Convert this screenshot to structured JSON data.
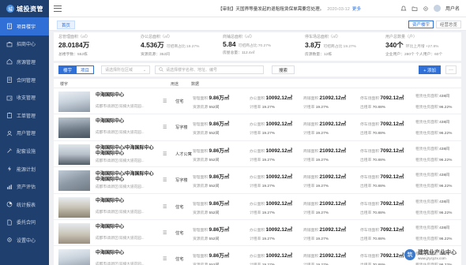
{
  "app": {
    "logo_text": "城投资管",
    "logo_mark": "城"
  },
  "sidebar": {
    "items": [
      {
        "label": "项目楼宇",
        "icon": "building-icon",
        "active": true
      },
      {
        "label": "招商中心",
        "icon": "briefcase-icon"
      },
      {
        "label": "房源管理",
        "icon": "house-icon"
      },
      {
        "label": "合同管理",
        "icon": "contract-icon"
      },
      {
        "label": "收支管理",
        "icon": "wallet-icon"
      },
      {
        "label": "工单管理",
        "icon": "clipboard-icon"
      },
      {
        "label": "用户管理",
        "icon": "user-icon"
      },
      {
        "label": "配套设施",
        "icon": "tools-icon"
      },
      {
        "label": "能源计划",
        "icon": "bolt-icon"
      },
      {
        "label": "资产评估",
        "icon": "chart-icon"
      },
      {
        "label": "统计报表",
        "icon": "report-icon"
      },
      {
        "label": "委托合同",
        "icon": "document-icon"
      },
      {
        "label": "设置中心",
        "icon": "gear-icon"
      }
    ]
  },
  "topbar": {
    "notice_tag": "【审批】",
    "notice_text": "天国界等量发起的退租租赁保单需要您处理。",
    "notice_date": "2020-03-12",
    "notice_more": "更多",
    "username": "用户名"
  },
  "tabs": {
    "home": "首页",
    "asset_tree": "资产楼宇",
    "overview": "经营总览"
  },
  "stats": [
    {
      "label": "总管理面积（㎡）",
      "value": "28.0184万",
      "sub": "",
      "foot": "总楼宇数：552栋"
    },
    {
      "label": "办公总面积（㎡）",
      "value": "4.536万",
      "sub": "可招商占比:19.27%",
      "foot": "资源房源：352间"
    },
    {
      "label": "商铺总面积（㎡）",
      "value": "5.84",
      "sub": "可招商占比:70.27%",
      "foot": "房屋总量：112.4㎡"
    },
    {
      "label": "停车场总面积（㎡）",
      "value": "3.8万",
      "sub": "可招商占比:19.27%",
      "foot": "房源数量：12栋"
    },
    {
      "label": "用户总数量（户）",
      "value": "340个",
      "sub": "环比上月增 +27.8%",
      "foot": "企业用户：280个   个人用户：60个"
    }
  ],
  "filters": {
    "tab_building": "楼宇",
    "tab_project": "项目",
    "select_placeholder": "请选择所在区域",
    "search_placeholder": "请选择楼宇名称、地址、编号",
    "search_button": "搜索",
    "add_button": "+ 添加",
    "more_button": "···"
  },
  "table": {
    "headers": {
      "building": "楼宇",
      "use": "用途",
      "data": "数据"
    },
    "labels": {
      "manage_area": "管理面积",
      "office_area": "办公面积",
      "shop_area": "商铺面积",
      "parking_area": "停车场面积",
      "housing": "租赁住房面积",
      "resources": "资源房源",
      "rent_rate": "出租率",
      "occupancy": "计租率"
    },
    "rows": [
      {
        "name": "中海国际中心",
        "address": "成都市/高新区/双楠大道花园...",
        "use": "住宅",
        "manage": "9.86万㎡",
        "office": "10092.12㎡",
        "shop": "21092.12㎡",
        "parking": "7092.12㎡",
        "housing": "438间",
        "res": "552间",
        "r1": "19.27%",
        "r2": "19.27%",
        "r3": "70.88%",
        "r4": "96.22%"
      },
      {
        "name": "中海国际中心",
        "address": "成都市/高新区/双楠大道花园...",
        "use": "写字楼",
        "manage": "9.86万㎡",
        "office": "10092.12㎡",
        "shop": "21092.12㎡",
        "parking": "7092.12㎡",
        "housing": "438间",
        "res": "552间",
        "r1": "19.27%",
        "r2": "19.27%",
        "r3": "70.88%",
        "r4": "96.22%"
      },
      {
        "name": "中海国际中心/中海国际中心中海国际中心",
        "address": "成都市/高新区/双楠大道花园...",
        "use": "人才公寓",
        "manage": "9.86万㎡",
        "office": "10092.12㎡",
        "shop": "21092.12㎡",
        "parking": "7092.12㎡",
        "housing": "438间",
        "res": "552间",
        "r1": "19.27%",
        "r2": "19.27%",
        "r3": "70.88%",
        "r4": "96.22%"
      },
      {
        "name": "中海国际中心/中海国际中心中海国际中心",
        "address": "成都市/高新区/双楠大道花园...",
        "use": "写字楼",
        "manage": "9.86万㎡",
        "office": "10092.12㎡",
        "shop": "21092.12㎡",
        "parking": "7092.12㎡",
        "housing": "438间",
        "res": "552间",
        "r1": "19.27%",
        "r2": "19.27%",
        "r3": "70.88%",
        "r4": "96.22%"
      },
      {
        "name": "中海国际中心",
        "address": "成都市/高新区/双楠大道花园...",
        "use": "住宅",
        "manage": "9.86万㎡",
        "office": "10092.12㎡",
        "shop": "21092.12㎡",
        "parking": "7092.12㎡",
        "housing": "438间",
        "res": "552间",
        "r1": "19.27%",
        "r2": "19.27%",
        "r3": "70.88%",
        "r4": "96.22%"
      },
      {
        "name": "中海国际中心",
        "address": "成都市/高新区/双楠大道花园...",
        "use": "住宅",
        "manage": "9.86万㎡",
        "office": "10092.12㎡",
        "shop": "21092.12㎡",
        "parking": "7092.12㎡",
        "housing": "438间",
        "res": "552间",
        "r1": "19.27%",
        "r2": "19.27%",
        "r3": "70.88%",
        "r4": "96.22%"
      },
      {
        "name": "中海国际中心",
        "address": "成都市/高新区/双楠大道花园...",
        "use": "住宅",
        "manage": "9.86万㎡",
        "office": "10092.12㎡",
        "shop": "21092.12㎡",
        "parking": "7092.12㎡",
        "housing": "438间",
        "res": "552间",
        "r1": "19.27%",
        "r2": "19.27%",
        "r3": "70.88%",
        "r4": "96.22%"
      }
    ]
  },
  "watermark": {
    "mark": "筑",
    "text": "建筑业产业中心",
    "url": "www.jzycyzx.com"
  },
  "colors": {
    "sidebar": "#1f3f6e",
    "accent": "#2f6fd6"
  }
}
